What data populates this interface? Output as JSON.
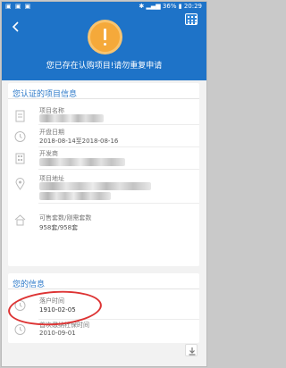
{
  "statusbar": {
    "signal": "••",
    "battery_pct": "36%",
    "time": "20:29"
  },
  "headline": "您已存在认购项目!请勿重复申请",
  "project_card": {
    "title": "您认证的项目信息",
    "fields": [
      {
        "label": "项目名称",
        "value": ""
      },
      {
        "label": "开盘日期",
        "value": "2018-08-14至2018-08-16"
      },
      {
        "label": "开发商",
        "value": ""
      },
      {
        "label": "项目地址",
        "value": ""
      },
      {
        "label": "可售套数/刚需套数",
        "value": "958套/958套"
      }
    ]
  },
  "personal_card": {
    "title": "您的信息",
    "fields": [
      {
        "label": "落户时间",
        "value": "1910-02-05"
      },
      {
        "label": "首次缴纳社保时间",
        "value": "2010-09-01"
      }
    ]
  },
  "annotation": {
    "color": "#d33333"
  },
  "colors": {
    "header": "#1e73c8",
    "accent_title": "#2c79c9",
    "warning": "#f5a93a"
  },
  "icons": [
    "back-arrow-icon",
    "grid-menu-icon",
    "exclamation-icon",
    "document-icon",
    "clock-icon",
    "building-icon",
    "location-pin-icon",
    "house-icon",
    "download-icon"
  ]
}
